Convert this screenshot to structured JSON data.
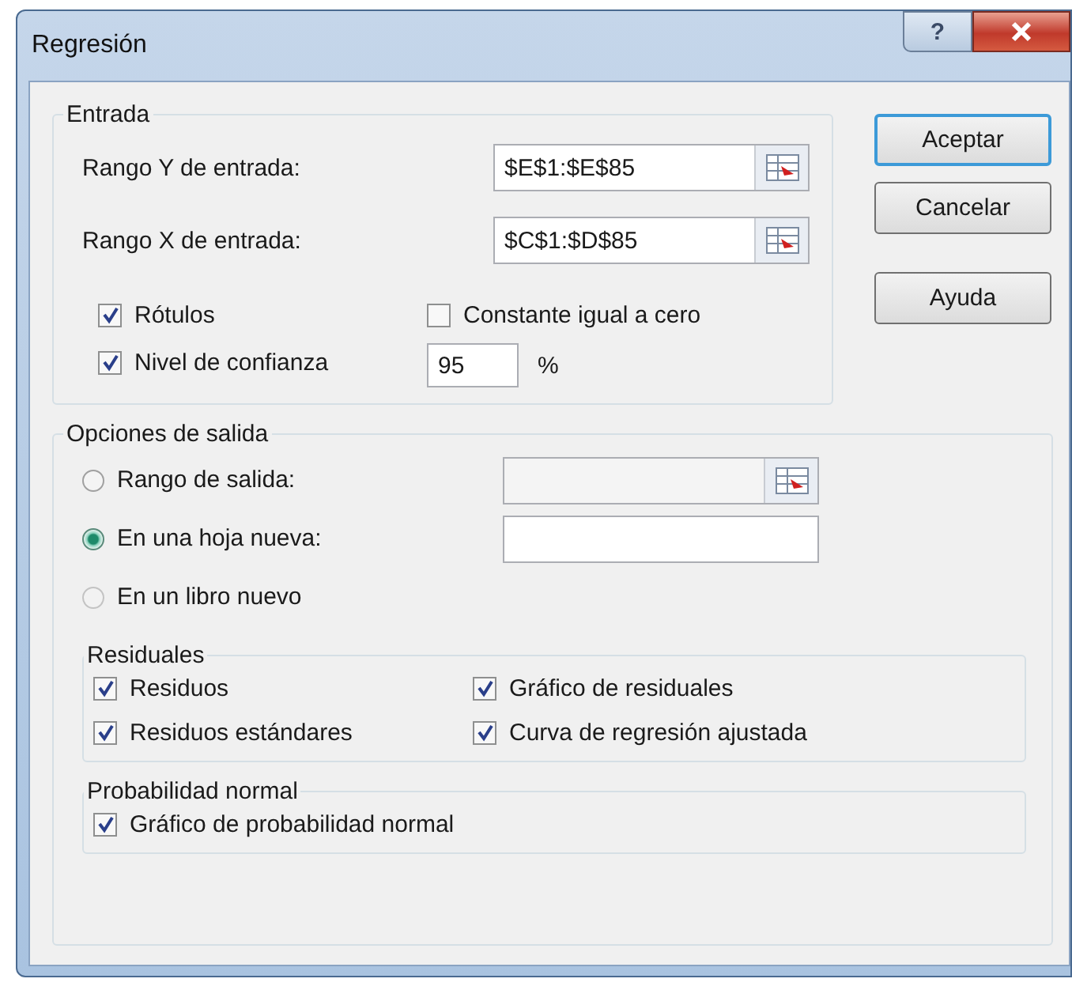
{
  "window": {
    "title": "Regresión",
    "help_button": "?"
  },
  "input_group": {
    "title": "Entrada",
    "fields": [
      {
        "label": "Rango Y de entrada:",
        "value": "$E$1:$E$85"
      },
      {
        "label": "Rango X de entrada:",
        "value": "$C$1:$D$85"
      }
    ],
    "checkboxes": [
      {
        "label": "Rótulos",
        "checked": true
      },
      {
        "label": "Constante igual a cero",
        "checked": false
      },
      {
        "label": "Nivel de confianza",
        "checked": true
      }
    ],
    "confidence": {
      "value": "95",
      "unit": "%"
    }
  },
  "buttons": [
    {
      "label": "Aceptar",
      "default": true
    },
    {
      "label": "Cancelar",
      "default": false
    },
    {
      "label": "Ayuda",
      "default": false
    }
  ],
  "output_group": {
    "title": "Opciones de salida",
    "options": [
      {
        "label": "Rango de salida:",
        "selected": false,
        "kind": "range"
      },
      {
        "label": "En una hoja nueva:",
        "selected": true,
        "kind": "sheet"
      },
      {
        "label": "En un libro nuevo",
        "selected": false,
        "kind": "book"
      }
    ],
    "residuals": {
      "title": "Residuales",
      "checkboxes": [
        {
          "label": "Residuos",
          "checked": true
        },
        {
          "label": "Gráfico de residuales",
          "checked": true
        },
        {
          "label": "Residuos estándares",
          "checked": true
        },
        {
          "label": "Curva de regresión ajustada",
          "checked": true
        }
      ]
    },
    "normal_probability": {
      "title": "Probabilidad normal",
      "checkboxes": [
        {
          "label": "Gráfico de probabilidad normal",
          "checked": true
        }
      ]
    }
  }
}
